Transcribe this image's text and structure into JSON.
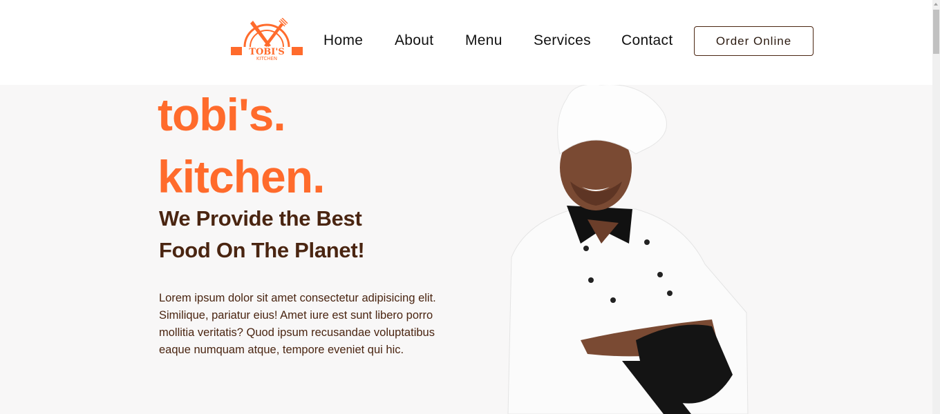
{
  "header": {
    "logo": {
      "text": "TOBI'S",
      "subtext": "KITCHEN",
      "color": "#ff6b2c"
    },
    "nav": [
      {
        "label": "Home"
      },
      {
        "label": "About"
      },
      {
        "label": "Menu"
      },
      {
        "label": "Services"
      },
      {
        "label": "Contact"
      }
    ],
    "order_button": "Order Online"
  },
  "hero": {
    "title_line1": "tobi's.",
    "title_line2": "kitchen.",
    "subtitle_line1": "We Provide the Best",
    "subtitle_line2": "Food On The Planet!",
    "paragraph": "Lorem ipsum dolor sit amet consectetur adipisicing elit. Similique, pariatur eius! Amet iure est sunt libero porro mollitia veritatis? Quod ipsum recusandae voluptatibus eaque numquam atque, tempore eveniet qui hic.",
    "image": "chef-photo"
  },
  "colors": {
    "accent": "#ff6b2c",
    "brown": "#4a2511",
    "background": "#f8f7f7"
  }
}
